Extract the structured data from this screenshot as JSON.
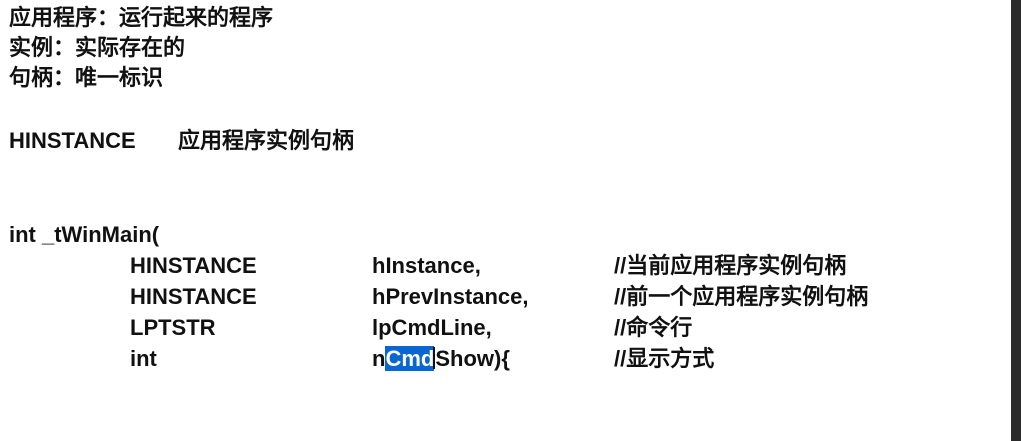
{
  "intro": {
    "line1": "应用程序：运行起来的程序",
    "line2": "实例：实际存在的",
    "line3": "句柄：唯一标识"
  },
  "hinstance": {
    "type": "HINSTANCE",
    "desc": "应用程序实例句柄"
  },
  "signature": {
    "header": "int _tWinMain(",
    "params": [
      {
        "type": "HINSTANCE",
        "name": "hInstance,",
        "comment": "//当前应用程序实例句柄"
      },
      {
        "type": "HINSTANCE",
        "name": "hPrevInstance,",
        "comment": "//前一个应用程序实例句柄"
      },
      {
        "type": "LPTSTR",
        "name": "lpCmdLine,",
        "comment": "//命令行"
      },
      {
        "type": "int",
        "name_prefix": "n",
        "name_selected": "Cmd",
        "name_suffix": "Show){",
        "comment": "//显示方式"
      }
    ]
  },
  "colors": {
    "selection": "#0a66d0",
    "text": "#111111",
    "background": "#ffffff"
  }
}
